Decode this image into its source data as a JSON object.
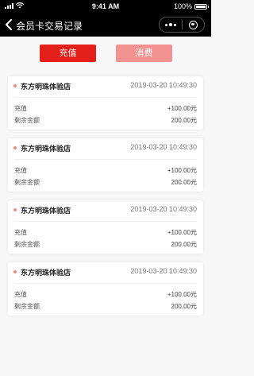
{
  "status_bar": {
    "carrier_icon": "signal-bars",
    "wifi_icon": "wifi",
    "time": "9:41 AM",
    "battery_percent": "100%"
  },
  "nav": {
    "back_icon": "chevron-left",
    "title": "会员卡交易记录",
    "more_icon": "ellipsis",
    "close_icon": "target-circle"
  },
  "tabs": [
    {
      "label": "充值",
      "active": true
    },
    {
      "label": "消费",
      "active": false
    }
  ],
  "colors": {
    "active_tab": "#e41f19",
    "inactive_tab": "#f29291",
    "dot": "#f08a88"
  },
  "records": [
    {
      "store": "东方明珠体验店",
      "datetime": "2019-03-20 10:49:30",
      "type_label": "充值",
      "amount": "+100.00元",
      "balance_label": "剩余金额",
      "balance": "200.00元"
    },
    {
      "store": "东方明珠体验店",
      "datetime": "2019-03-20 10:49:30",
      "type_label": "充值",
      "amount": "+100.00元",
      "balance_label": "剩余金额",
      "balance": "200.00元"
    },
    {
      "store": "东方明珠体验店",
      "datetime": "2019-03-20 10:49:30",
      "type_label": "充值",
      "amount": "+100.00元",
      "balance_label": "剩余金额",
      "balance": "200.00元"
    },
    {
      "store": "东方明珠体验店",
      "datetime": "2019-03-20 10:49:30",
      "type_label": "充值",
      "amount": "+100.00元",
      "balance_label": "剩余金额",
      "balance": "200.00元"
    }
  ]
}
